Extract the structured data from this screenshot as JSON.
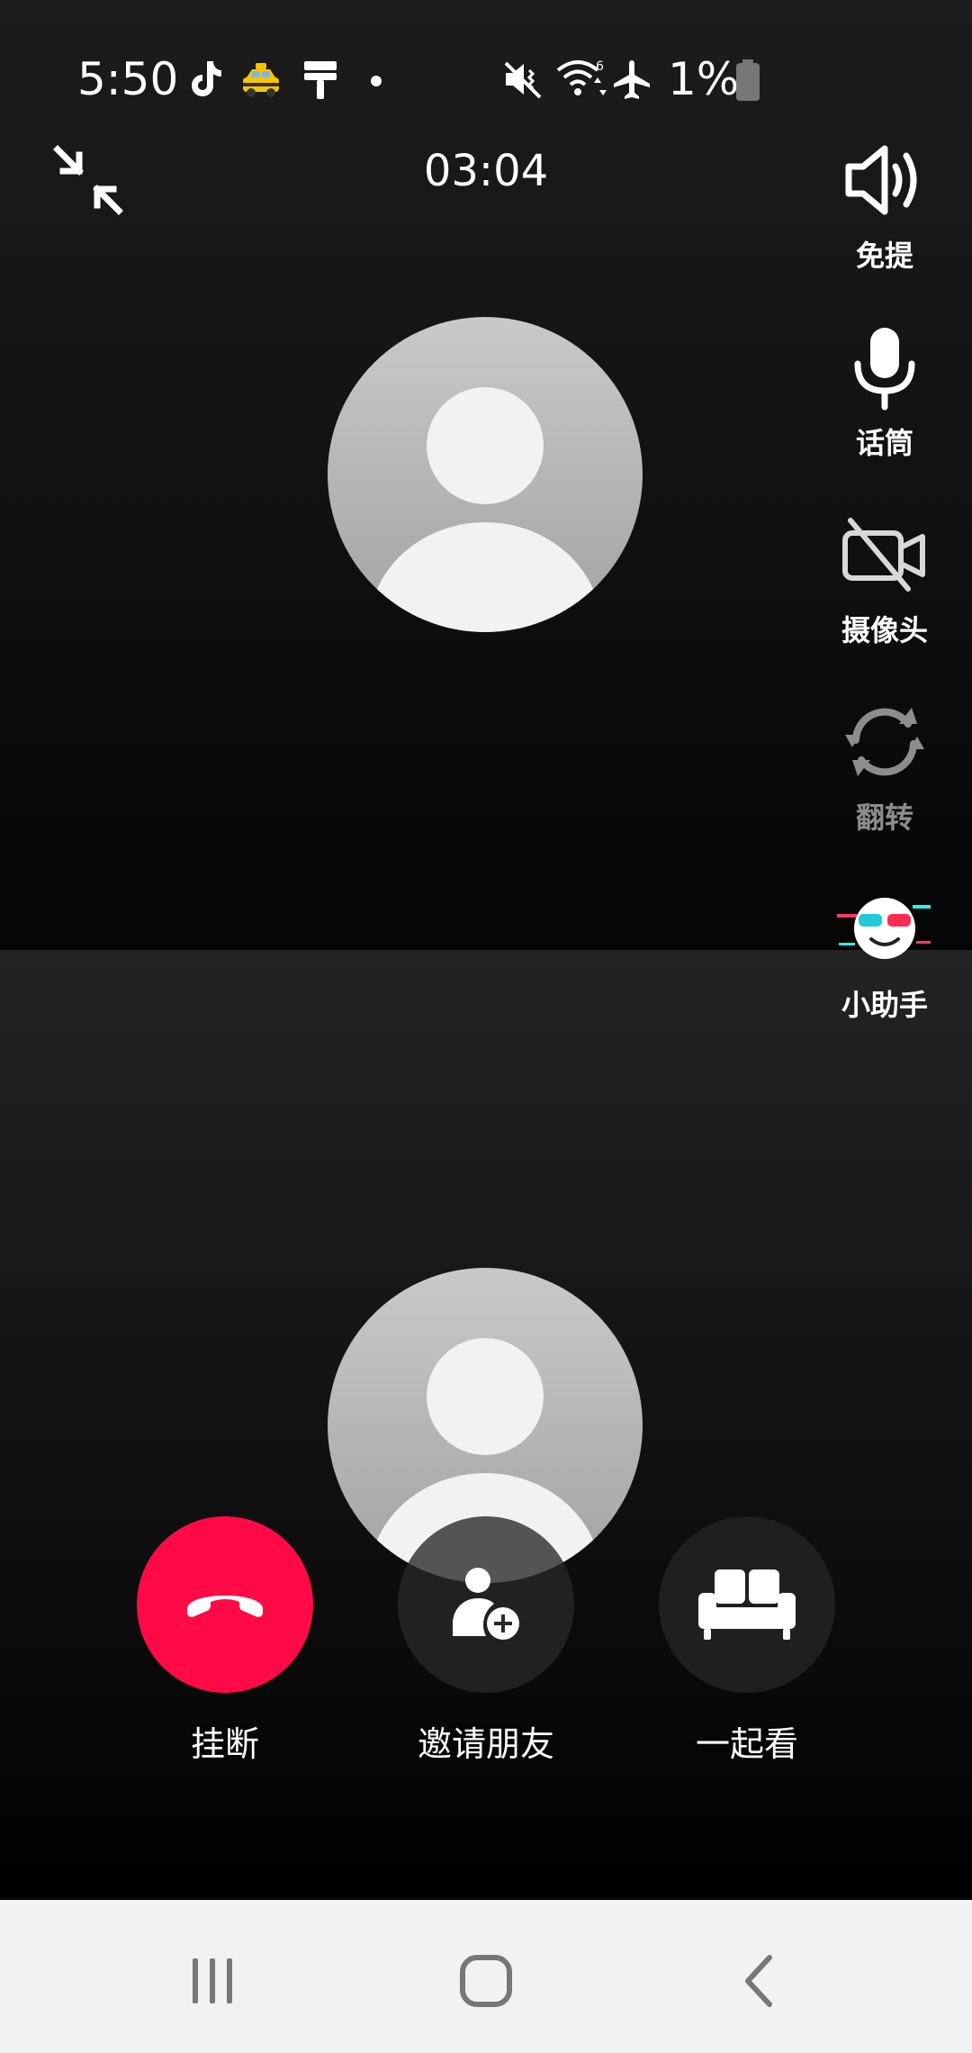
{
  "status_bar": {
    "time": "5:50",
    "battery_percent": "1%",
    "icons": [
      "tiktok-icon",
      "taxi-emoji-icon",
      "paint-roller-icon",
      "dot-icon",
      "mute-vibrate-icon",
      "wifi-6-icon",
      "airplane-mode-icon",
      "battery-low-icon"
    ]
  },
  "call": {
    "timer": "03:04",
    "minimize_icon": "collapse-arrows-icon"
  },
  "side_controls": [
    {
      "label": "免提",
      "icon": "speaker-icon",
      "enabled": true
    },
    {
      "label": "话筒",
      "icon": "microphone-icon",
      "enabled": true
    },
    {
      "label": "摄像头",
      "icon": "camera-off-icon",
      "enabled": true
    },
    {
      "label": "翻转",
      "icon": "flip-camera-icon",
      "enabled": false
    },
    {
      "label": "小助手",
      "icon": "assistant-avatar-icon",
      "enabled": true
    }
  ],
  "actions": [
    {
      "label": "挂断",
      "icon": "hang-up-phone-icon",
      "color": "#fe0a46"
    },
    {
      "label": "邀请朋友",
      "icon": "add-person-icon",
      "color": "#2a2a2a"
    },
    {
      "label": "一起看",
      "icon": "sofa-icon",
      "color": "#1f1f1f"
    }
  ],
  "nav_bar": {
    "buttons": [
      "recent-apps-icon",
      "home-icon",
      "back-icon"
    ]
  }
}
